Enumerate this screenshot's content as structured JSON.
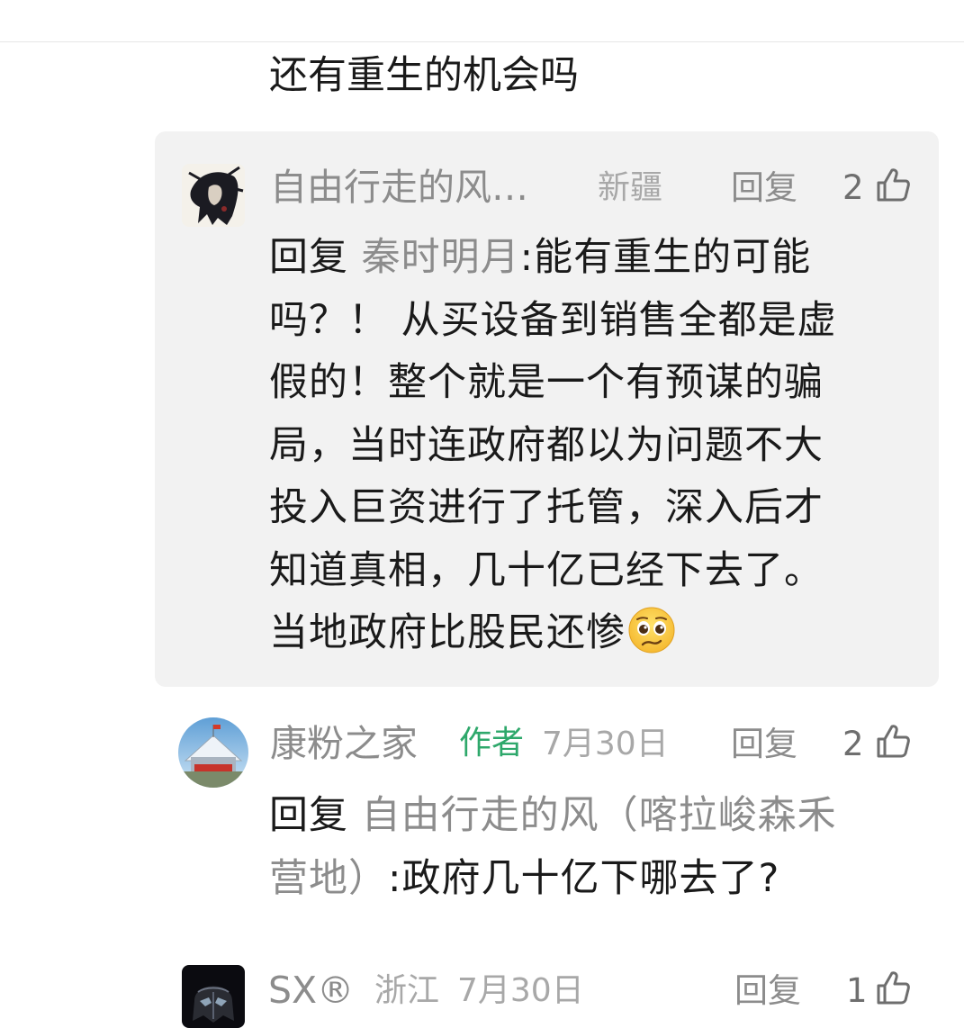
{
  "topbar": {
    "close_icon": "close-icon"
  },
  "previous_comment": {
    "text": "还有重生的机会吗"
  },
  "replies": [
    {
      "avatar_icon": "ink-portrait-avatar",
      "name": "自由行走的风…",
      "location": "新疆",
      "reply_label": "回复",
      "likes": "2",
      "reply_prefix": "回复",
      "reply_target": "秦时明月",
      "reply_colon": ":",
      "text_line1": "能有重生的可能",
      "lines": [
        "吗？！ 从买设备到销售全都是虚",
        "假的！整个就是一个有预谋的骗",
        "局，当时连政府都以为问题不大",
        "投入巨资进行了托管，深入后才",
        "知道真相，几十亿已经下去了。"
      ],
      "last_line": "当地政府比股民还惨",
      "emoji": "pleading-face-emoji"
    },
    {
      "avatar_icon": "building-avatar",
      "name": "康粉之家",
      "author_tag": "作者",
      "date": "7月30日",
      "reply_label": "回复",
      "likes": "2",
      "reply_prefix": "回复",
      "reply_target_line1": "自由行走的风（喀拉峻森禾",
      "reply_target_line2": "营地）",
      "reply_colon": ":",
      "text": "政府几十亿下哪去了?"
    },
    {
      "avatar_icon": "darth-vader-avatar",
      "name": "SX®",
      "location": "浙江",
      "date": "7月30日",
      "reply_label": "回复",
      "likes": "1"
    }
  ],
  "colors": {
    "reply_box_bg": "#f2f2f2",
    "author_green": "#2ea86b",
    "muted_gray": "#8c8c8c"
  }
}
